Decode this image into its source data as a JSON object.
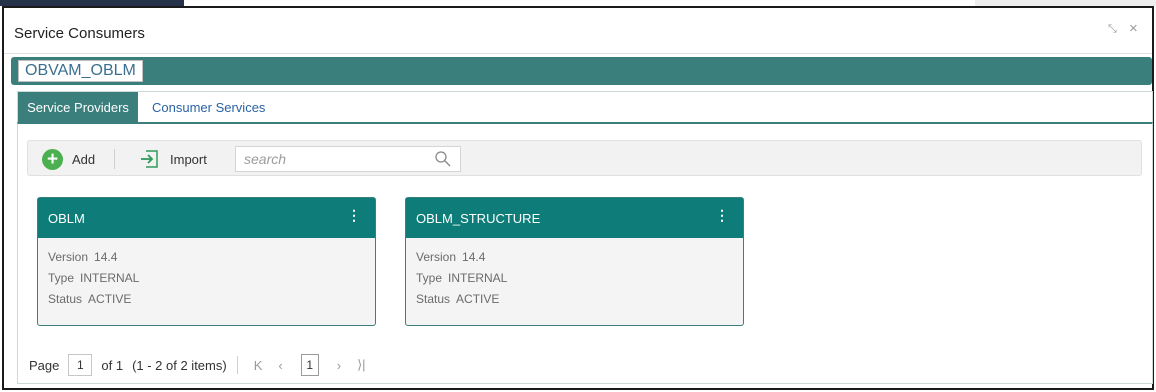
{
  "window": {
    "title": "Service Consumers"
  },
  "context": {
    "name": "OBVAM_OBLM"
  },
  "tabs": [
    {
      "label": "Service Providers"
    },
    {
      "label": "Consumer Services"
    }
  ],
  "toolbar": {
    "add_label": "Add",
    "import_label": "Import",
    "search_placeholder": "search"
  },
  "cards": [
    {
      "name": "OBLM",
      "version_label": "Version",
      "version": "14.4",
      "type_label": "Type",
      "type": "INTERNAL",
      "status_label": "Status",
      "status": "ACTIVE"
    },
    {
      "name": "OBLM_STRUCTURE",
      "version_label": "Version",
      "version": "14.4",
      "type_label": "Type",
      "type": "INTERNAL",
      "status_label": "Status",
      "status": "ACTIVE"
    }
  ],
  "pagination": {
    "page_label": "Page",
    "current_page": "1",
    "of_label": "of 1",
    "items_summary": "(1 - 2 of 2 items)",
    "page_button": "1"
  },
  "colors": {
    "accent": "#3a7f7c",
    "card_header": "#0e7c78",
    "link": "#2a63a5",
    "add_green": "#4caf50"
  }
}
